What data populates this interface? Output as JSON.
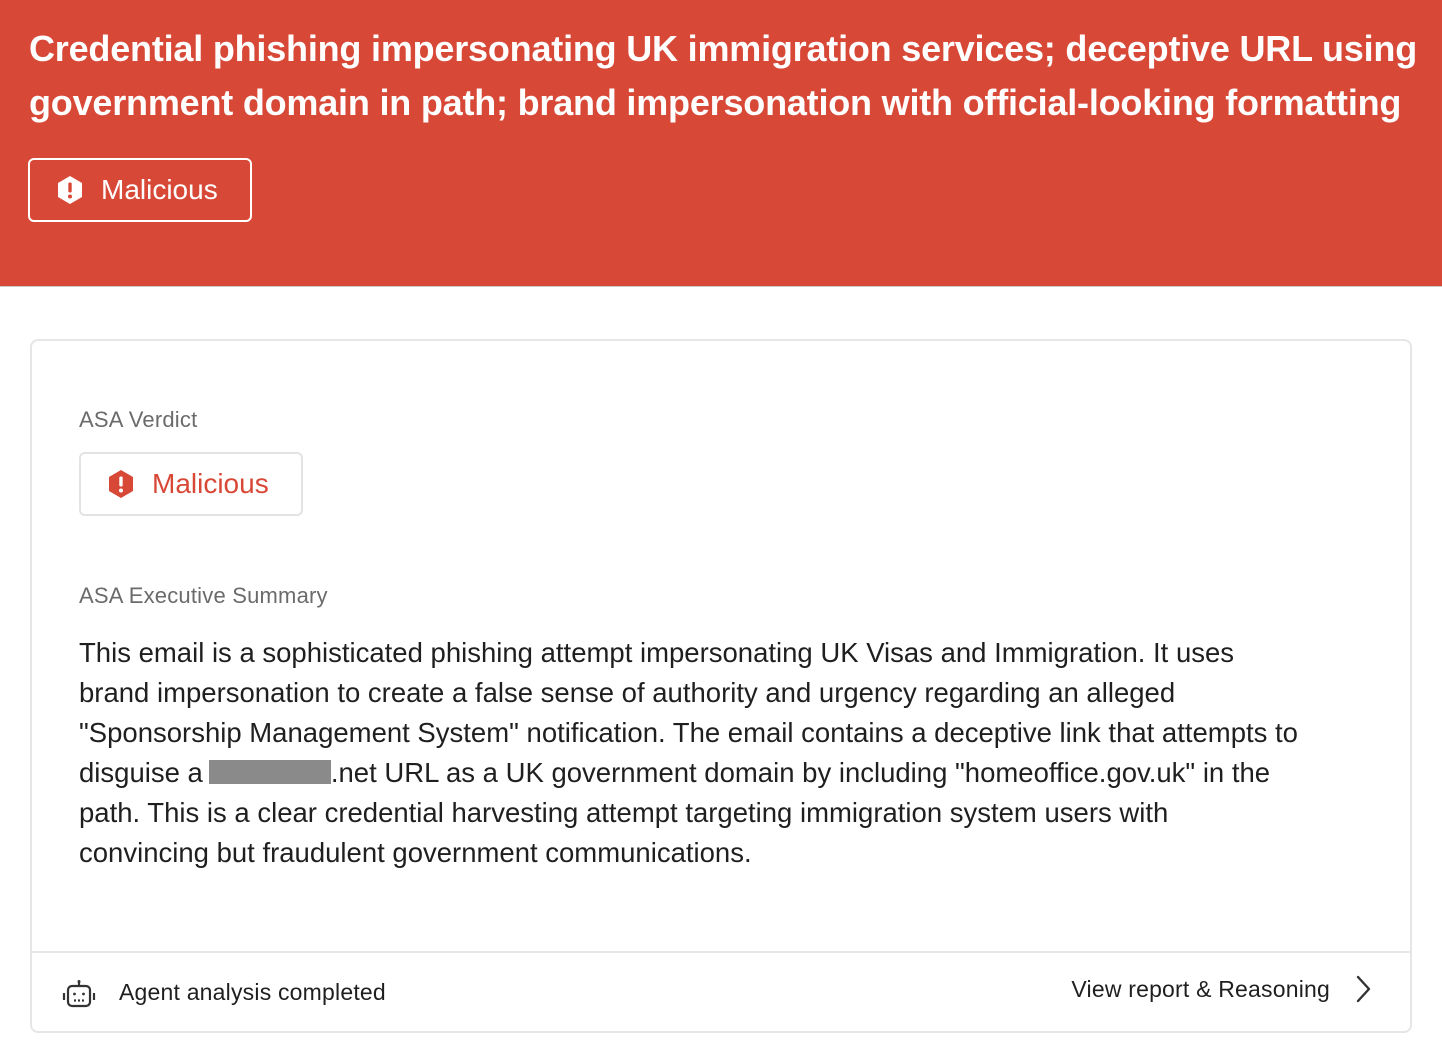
{
  "header": {
    "title": "Credential phishing impersonating UK immigration services; deceptive URL using government domain in path; brand impersonation with official-looking formatting",
    "badge_label": "Malicious",
    "badge_icon": "alert-hexagon-icon",
    "background_color": "#d84837"
  },
  "card": {
    "verdict_label": "ASA Verdict",
    "verdict_value": "Malicious",
    "verdict_icon": "alert-hexagon-icon",
    "verdict_color": "#d84837",
    "summary_label": "ASA Executive Summary",
    "summary_part1": "This email is a sophisticated phishing attempt impersonating UK Visas and Immigration. It uses brand impersonation to create a false sense of authority and urgency regarding an alleged \"Sponsorship Management System\" notification. The email contains a deceptive link that attempts to disguise a",
    "summary_part2": ".net URL as a UK government domain by including \"homeoffice.gov.uk\" in the path. This is a clear credential harvesting attempt targeting immigration system users with convincing but fraudulent government communications."
  },
  "footer": {
    "status_icon": "robot-icon",
    "status_text": "Agent analysis completed",
    "link_label": "View report & Reasoning",
    "link_icon": "chevron-right-icon"
  }
}
